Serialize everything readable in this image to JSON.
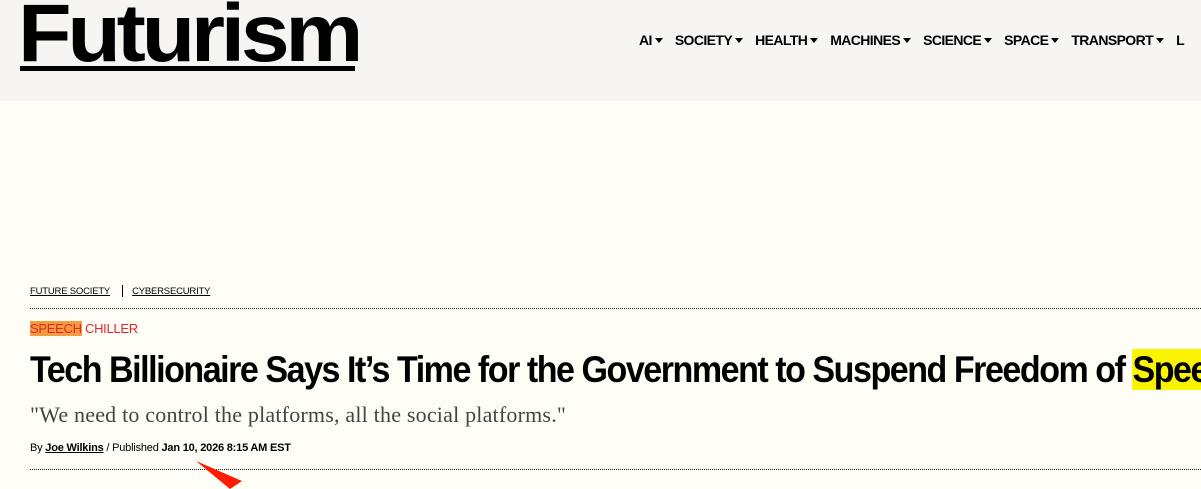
{
  "site": {
    "logo": "Futurism"
  },
  "nav": {
    "items": [
      {
        "label": "AI"
      },
      {
        "label": "SOCIETY"
      },
      {
        "label": "HEALTH"
      },
      {
        "label": "MACHINES"
      },
      {
        "label": "SCIENCE"
      },
      {
        "label": "SPACE"
      },
      {
        "label": "TRANSPORT"
      },
      {
        "label": "L"
      }
    ]
  },
  "article": {
    "tags": [
      "FUTURE SOCIETY",
      "CYBERSECURITY"
    ],
    "kicker": {
      "highlighted": "SPEECH",
      "rest": " CHILLER"
    },
    "headline": {
      "main": "Tech Billionaire Says It’s Time for the Government to Suspend Freedom of ",
      "highlighted": "Speech"
    },
    "dek": "\"We need to control the platforms, all the social platforms.\"",
    "byline": {
      "by_label": "By ",
      "author": "Joe Wilkins",
      "separator": " / ",
      "published_label": "Published ",
      "date": "Jan 10, 2026 8:15 AM EST"
    }
  },
  "colors": {
    "header_bg": "#f6f5f1",
    "page_bg": "#fffef6",
    "kicker_red": "#e0252d",
    "kicker_highlight": "#f49a3f",
    "headline_highlight": "#fbf400",
    "annotation_arrow": "#ff1a00"
  },
  "icons": {
    "nav_caret": "caret-down-icon",
    "annotation": "red-arrow-icon"
  }
}
